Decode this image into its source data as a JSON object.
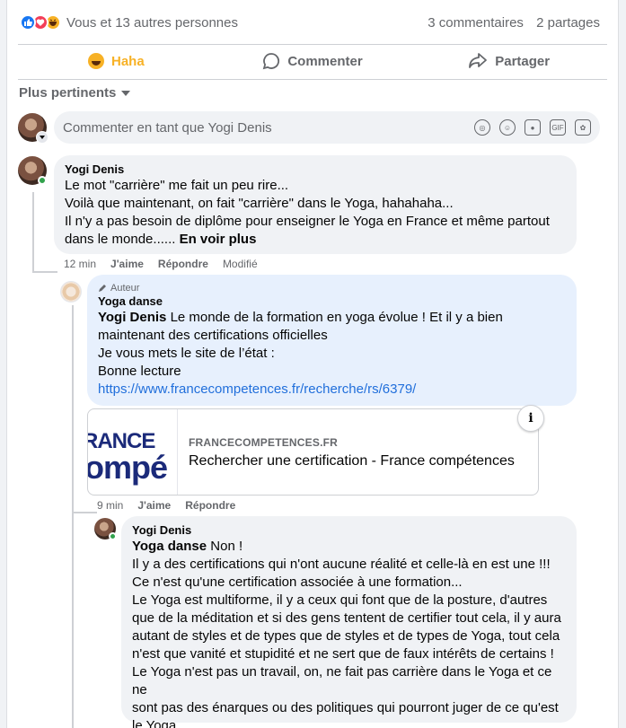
{
  "reactions": {
    "summary": "Vous et 13 autres personnes",
    "comments_count": "3 commentaires",
    "shares_count": "2 partages",
    "icons": [
      "like-icon",
      "love-icon",
      "haha-icon"
    ],
    "colors": {
      "like": "#1877f2",
      "love": "#f33e58",
      "haha": "#f7b125"
    }
  },
  "actions": {
    "react_label": "Haha",
    "comment_label": "Commenter",
    "share_label": "Partager"
  },
  "sort": {
    "label": "Plus pertinents"
  },
  "compose": {
    "placeholder": "Commenter en tant que Yogi Denis",
    "icons": [
      "avatar-icon",
      "emoji-icon",
      "camera-icon",
      "gif-icon",
      "sticker-icon"
    ]
  },
  "comments": [
    {
      "author": "Yogi Denis",
      "lines": [
        "Le mot \"carrière\" me fait un peu rire...",
        "Voilà que maintenant, on fait \"carrière\" dans le Yoga, hahahaha...",
        "Il n'y a pas besoin de diplôme pour enseigner le Yoga en France et même partout",
        "dans le monde......"
      ],
      "see_more": "En voir plus",
      "time": "12 min",
      "like": "J'aime",
      "reply": "Répondre",
      "edited": "Modifié"
    },
    {
      "badge": "Auteur",
      "author": "Yoga danse",
      "mention": "Yogi Denis",
      "lines": [
        "Le monde de la formation en yoga évolue ! Et il y a bien",
        "maintenant des certifications officielles",
        "Je vous mets le site de l’état :",
        "Bonne lecture"
      ],
      "link": "https://www.francecompetences.fr/recherche/rs/6379/",
      "preview": {
        "image_text_1": "RANCE",
        "image_text_2": "ompé",
        "domain": "FRANCECOMPETENCES.FR",
        "title": "Rechercher une certification - France compétences",
        "info": "i"
      },
      "time": "9 min",
      "like": "J'aime",
      "reply": "Répondre"
    },
    {
      "author": "Yogi Denis",
      "mention": "Yoga danse",
      "first_line_rest": "Non !",
      "lines": [
        "Il y a des certifications qui n'ont aucune réalité et celle-là en est une !!!",
        "Ce n'est qu'une certification associée à une formation...",
        "Le Yoga est multiforme, il y a ceux qui font que de la posture, d'autres",
        "que de la méditation et si des gens tentent de certifier tout cela, il y aura",
        "autant de styles et de types que de styles et de types de Yoga, tout cela",
        "n'est que vanité et stupidité et ne sert que de faux intérêts de certains !",
        "Le Yoga n'est pas un travail, on, ne fait pas carrière dans le Yoga et ce ne",
        "sont pas des énarques ou des politiques qui pourront juger de ce qu'est",
        "le Yoga."
      ]
    }
  ]
}
